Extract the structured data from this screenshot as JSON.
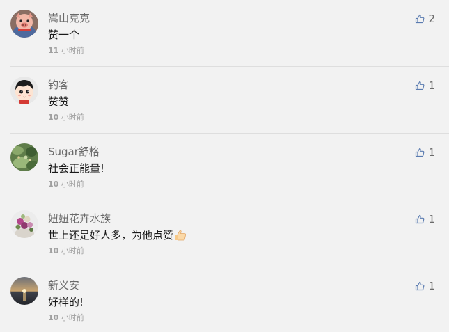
{
  "colors": {
    "background": "#f2f2f2",
    "name": "#6a6a6a",
    "text": "#1a1a1a",
    "time": "#a0a0a0",
    "like_icon": "#5a7bb0"
  },
  "comments": [
    {
      "avatar_icon": "pig-doll-avatar",
      "name": "嵩山克克",
      "text": "赞一个",
      "time_num": "11",
      "time_unit": "小时前",
      "likes": "2"
    },
    {
      "avatar_icon": "cartoon-boy-avatar",
      "name": "钓客",
      "text": "赞赞",
      "time_num": "10",
      "time_unit": "小时前",
      "likes": "1"
    },
    {
      "avatar_icon": "green-plant-avatar",
      "name": "Sugar舒格",
      "text": "社会正能量!",
      "time_num": "10",
      "time_unit": "小时前",
      "likes": "1"
    },
    {
      "avatar_icon": "flower-bouquet-avatar",
      "name": "妞妞花卉水族",
      "text": "世上还是好人多，为他点赞",
      "text_emoji": "thumbs-up-emoji",
      "time_num": "10",
      "time_unit": "小时前",
      "likes": "1"
    },
    {
      "avatar_icon": "sunset-sea-avatar",
      "name": "新义安",
      "text": "好样的!",
      "time_num": "10",
      "time_unit": "小时前",
      "likes": "1"
    }
  ]
}
